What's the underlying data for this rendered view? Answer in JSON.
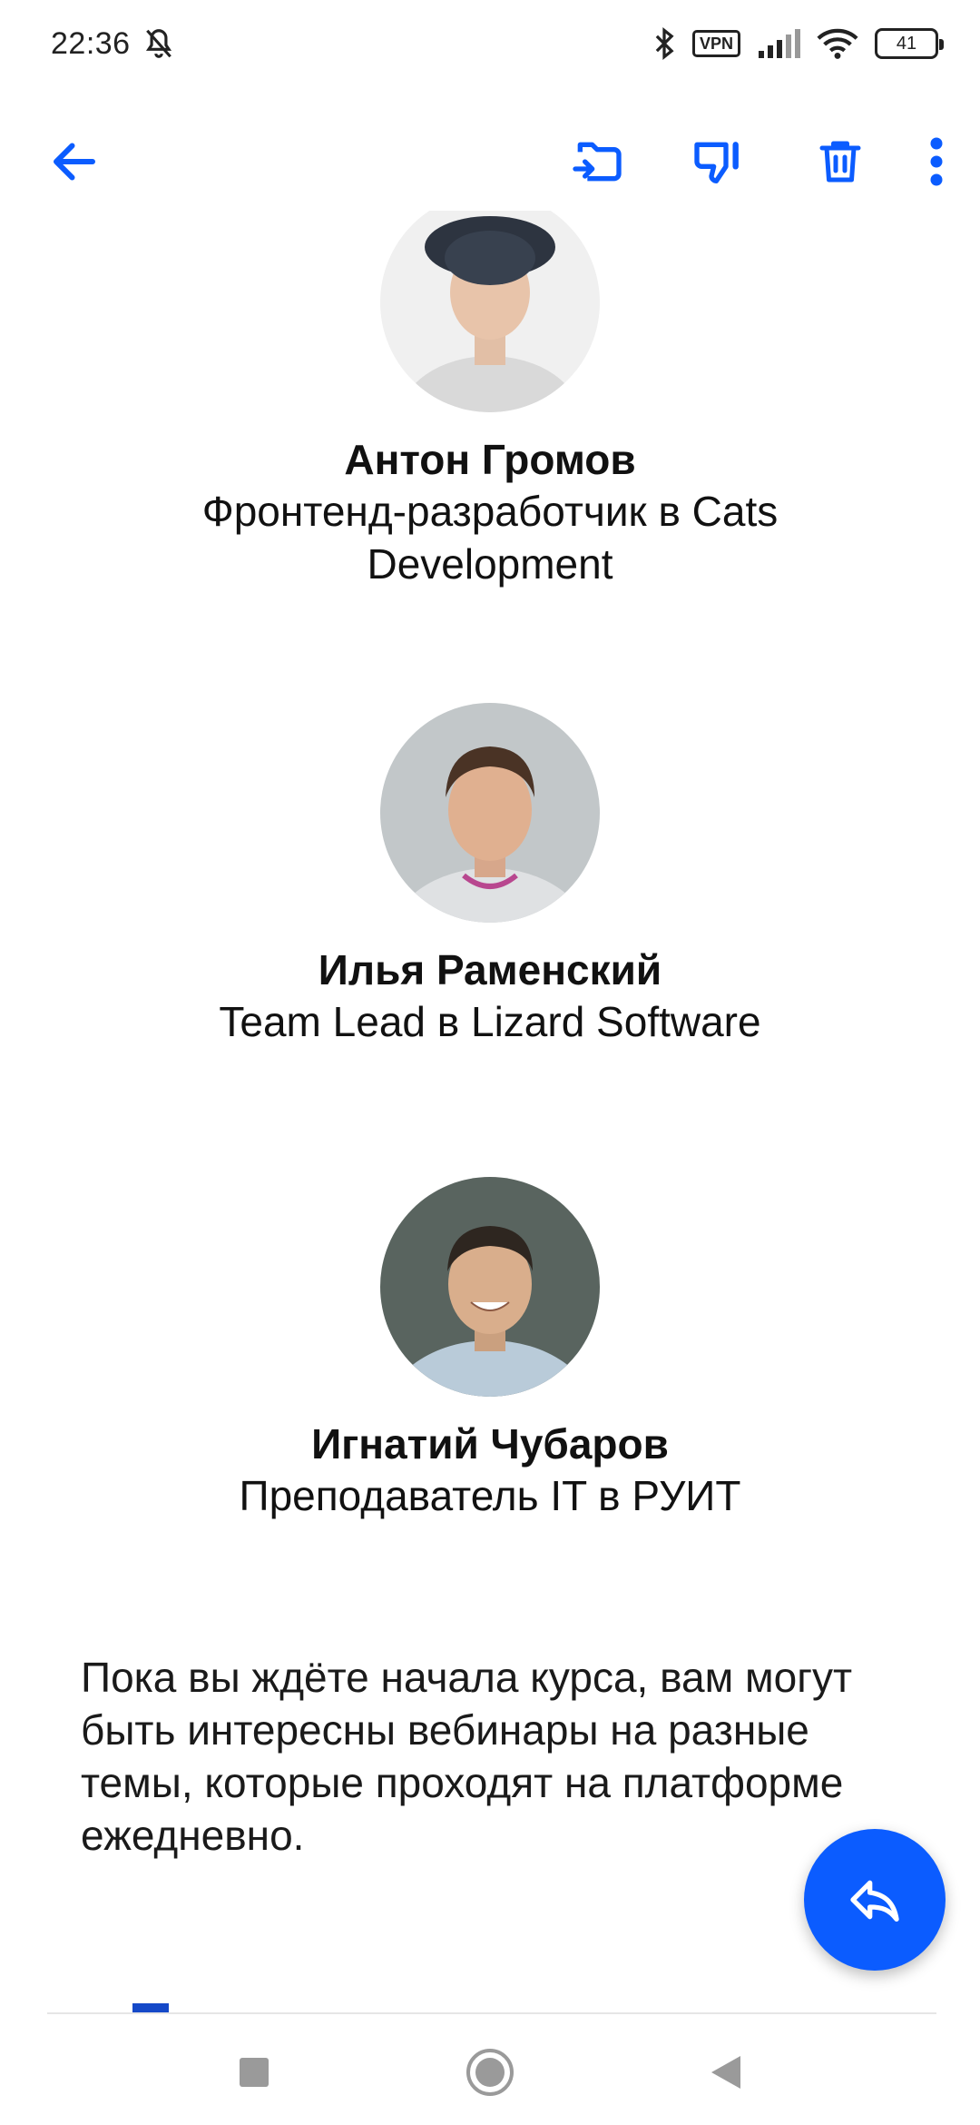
{
  "status_bar": {
    "time": "22:36",
    "vpn_label": "VPN",
    "battery_level": "41"
  },
  "toolbar": {
    "icons": [
      "back-arrow-icon",
      "move-to-folder-icon",
      "dislike-icon",
      "trash-icon",
      "more-vert-icon"
    ],
    "accent_color": "#0b5cff"
  },
  "people": [
    {
      "name": "Антон Громов",
      "role": "Фронтенд-разработчик в Cats Development"
    },
    {
      "name": "Илья Раменский",
      "role": "Team Lead в Lizard Software"
    },
    {
      "name": "Игнатий Чубаров",
      "role": "Преподаватель IT в РУИТ"
    }
  ],
  "body_text": "Пока вы ждёте начала курса, вам могут быть интересны вебинары на разные темы, которые проходят на платформе ежедневно.",
  "fab": {
    "icon": "reply-icon",
    "color": "#0b5cff"
  },
  "nav_bar": {
    "icons": [
      "recents-square-icon",
      "home-circle-icon",
      "back-triangle-icon"
    ]
  }
}
